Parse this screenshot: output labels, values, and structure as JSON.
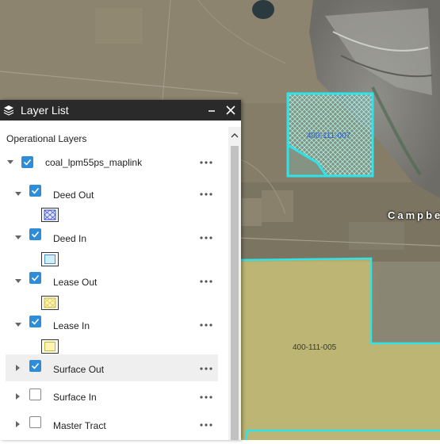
{
  "panel": {
    "title": "Layer List",
    "minimize_label": "—",
    "close_label": "✕",
    "section_title": "Operational Layers",
    "more_label": "•••"
  },
  "layers": [
    {
      "label": "coal_lpm55ps_maplink",
      "checked": true,
      "expanded": true
    },
    {
      "label": "Deed Out",
      "checked": true,
      "expanded": true,
      "swatch": "crosshatch-blue"
    },
    {
      "label": "Deed In",
      "checked": true,
      "expanded": true,
      "swatch": "light-blue"
    },
    {
      "label": "Lease Out",
      "checked": true,
      "expanded": true,
      "swatch": "crosshatch-yellow"
    },
    {
      "label": "Lease In",
      "checked": true,
      "expanded": true,
      "swatch": "light-yellow"
    },
    {
      "label": "Surface Out",
      "checked": true,
      "expanded": false
    },
    {
      "label": "Surface In",
      "checked": false,
      "expanded": false
    },
    {
      "label": "Master Tract",
      "checked": false,
      "expanded": false
    }
  ],
  "map": {
    "tract_labels": [
      "400-111-007",
      "400-111-005"
    ],
    "place_label": "Campbe",
    "colors": {
      "cyan_outline": "#2fe3e8",
      "yellow_fill": "#e6e07a",
      "hatch": "#b9f5ee"
    }
  }
}
